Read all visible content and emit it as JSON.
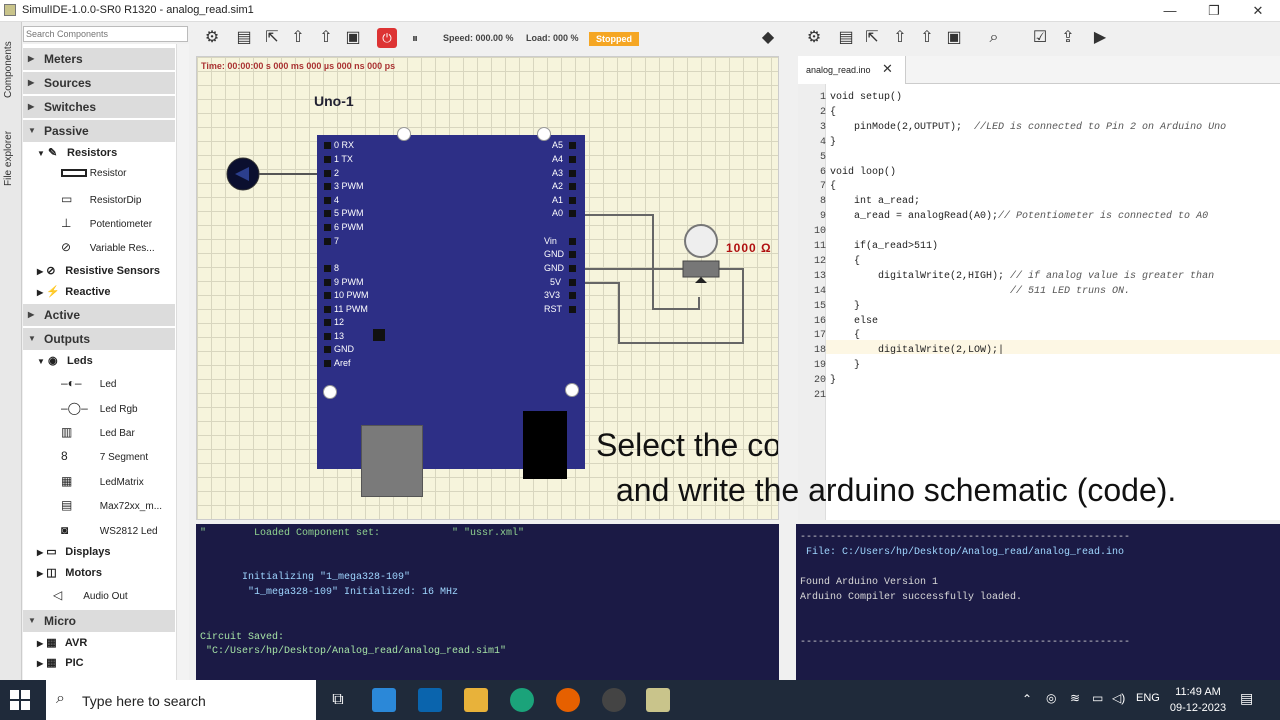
{
  "window": {
    "title": "SimulIDE-1.0.0-SR0 R1320  -  analog_read.sim1",
    "minimize": "—",
    "maximize": "❐",
    "close": "✕"
  },
  "side_tabs": [
    "Components",
    "File explorer"
  ],
  "search": {
    "placeholder": "Search Components"
  },
  "components": {
    "categories": [
      {
        "label": "Meters"
      },
      {
        "label": "Sources"
      },
      {
        "label": "Switches"
      },
      {
        "label": "Passive"
      },
      {
        "label": "Active"
      },
      {
        "label": "Outputs"
      },
      {
        "label": "Micro"
      }
    ],
    "passive": {
      "resistors_label": "Resistors",
      "items": [
        "Resistor",
        "ResistorDip",
        "Potentiometer",
        "Variable Res..."
      ],
      "resistive_sensors": "Resistive Sensors",
      "reactive": "Reactive"
    },
    "outputs": {
      "leds_label": "Leds",
      "items": [
        "Led",
        "Led Rgb",
        "Led Bar",
        "7 Segment",
        "LedMatrix",
        "Max72xx_m...",
        "WS2812 Led"
      ],
      "displays": "Displays",
      "motors": "Motors",
      "audio_out": "Audio Out"
    },
    "micro": {
      "items": [
        "AVR",
        "PIC"
      ]
    }
  },
  "toolbar": {
    "speed": "Speed: 000.00 %",
    "load": "Load: 000 %",
    "status": "Stopped",
    "status_color": "#f5a623"
  },
  "canvas": {
    "time": "Time: 00:00:00 s   000 ms  000 µs  000 ns  000 ps",
    "board_label": "Uno-1",
    "left_pins": [
      "0  RX",
      "1  TX",
      "2",
      "3  PWM",
      "4",
      "5  PWM",
      "6  PWM",
      "7",
      "8",
      "9  PWM",
      "10 PWM",
      "11 PWM",
      "12",
      "13",
      "GND",
      "Aref"
    ],
    "right_pins_top": [
      "A5",
      "A4",
      "A3",
      "A2",
      "A1",
      "A0"
    ],
    "right_pins_bottom": [
      "Vin",
      "GND",
      "GND",
      "5V",
      "3V3",
      "RST"
    ],
    "pot_value": "1000 Ω"
  },
  "editor": {
    "tab_label": "analog_read.ino",
    "tab_close": "✕",
    "lines": [
      {
        "n": "1",
        "code": "void setup()"
      },
      {
        "n": "2",
        "code": "{"
      },
      {
        "n": "3",
        "code": "    pinMode(2,OUTPUT);  ",
        "comment": "//LED is connected to Pin 2 on Arduino Uno"
      },
      {
        "n": "4",
        "code": "}"
      },
      {
        "n": "5",
        "code": ""
      },
      {
        "n": "6",
        "code": "void loop()"
      },
      {
        "n": "7",
        "code": "{"
      },
      {
        "n": "8",
        "code": "    int a_read;"
      },
      {
        "n": "9",
        "code": "    a_read = analogRead(A0);",
        "comment": "// Potentiometer is connected to A0"
      },
      {
        "n": "10",
        "code": ""
      },
      {
        "n": "11",
        "code": "    if(a_read>511)"
      },
      {
        "n": "12",
        "code": "    {"
      },
      {
        "n": "13",
        "code": "        digitalWrite(2,HIGH); ",
        "comment": "// if analog value is greater than"
      },
      {
        "n": "14",
        "code": "                              ",
        "comment": "// 511 LED truns ON."
      },
      {
        "n": "15",
        "code": "    }"
      },
      {
        "n": "16",
        "code": "    else"
      },
      {
        "n": "17",
        "code": "    {"
      },
      {
        "n": "18",
        "code": "        digitalWrite(2,LOW);|"
      },
      {
        "n": "19",
        "code": "    }"
      },
      {
        "n": "20",
        "code": "}"
      },
      {
        "n": "21",
        "code": ""
      }
    ]
  },
  "console_left": {
    "lines": [
      "\"        Loaded Component set:            \" \"ussr.xml\"",
      "",
      "",
      "       Initializing \"1_mega328-109\"",
      "        \"1_mega328-109\" Initialized: 16 MHz",
      "",
      "",
      "Circuit Saved:",
      " \"C:/Users/hp/Desktop/Analog_read/analog_read.sim1\""
    ]
  },
  "console_right": {
    "lines": [
      "-------------------------------------------------------",
      " File: C:/Users/hp/Desktop/Analog_read/analog_read.ino",
      "",
      "Found Arduino Version 1",
      "Arduino Compiler successfully loaded.",
      "",
      "",
      "-------------------------------------------------------"
    ]
  },
  "caption": {
    "line1": "Select the compiler window on Right hand",
    "line2": "and write the arduino schematic (code)."
  },
  "taskbar": {
    "search_placeholder": "Type here to search",
    "lang": "ENG",
    "time": "11:49 AM",
    "date": "09-12-2023"
  }
}
